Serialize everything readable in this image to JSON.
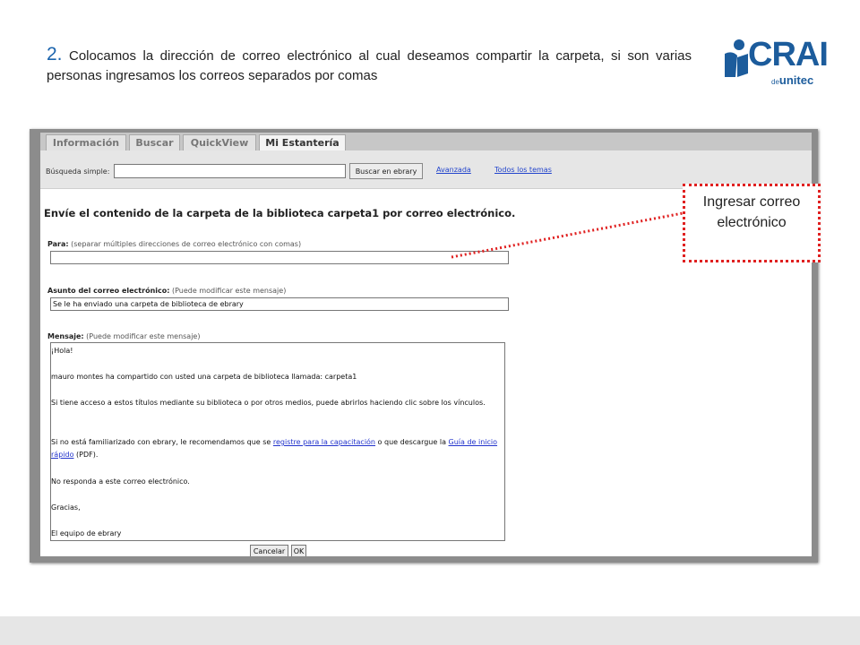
{
  "slide": {
    "step_number": "2.",
    "step_text": "Colocamos la dirección de correo electrónico al cual deseamos compartir la carpeta, si son varias personas ingresamos los correos separados por comas"
  },
  "logo": {
    "brand": "CRAI",
    "sub_prefix": "de",
    "sub": "unitec"
  },
  "tabs": [
    {
      "label": "Información",
      "active": false
    },
    {
      "label": "Buscar",
      "active": false
    },
    {
      "label": "QuickView",
      "active": false
    },
    {
      "label": "Mi Estantería",
      "active": true
    }
  ],
  "search": {
    "label": "Búsqueda simple:",
    "value": "",
    "button": "Buscar en ebrary",
    "advanced": "Avanzada",
    "all_topics": "Todos los temas"
  },
  "form": {
    "title": "Envíe el contenido de la carpeta de la biblioteca carpeta1 por correo electrónico.",
    "to_label": "Para:",
    "to_hint": "(separar múltiples direcciones de correo electrónico con comas)",
    "to_value": "",
    "subject_label": "Asunto del correo electrónico:",
    "subject_hint": "(Puede modificar este mensaje)",
    "subject_value": "Se le ha enviado una carpeta de biblioteca de ebrary",
    "message_label": "Mensaje:",
    "message_hint": "(Puede modificar este mensaje)",
    "message": {
      "greeting": "¡Hola!",
      "line1": "mauro montes ha compartido con usted una carpeta de biblioteca llamada: carpeta1",
      "line2": "Si tiene acceso a estos títulos mediante su biblioteca o por otros medios, puede abrirlos haciendo clic sobre los vínculos.",
      "line3_pre": "Si no está familiarizado con ebrary, le recomendamos que se ",
      "line3_link1": "registre para la capacitación",
      "line3_mid": " o que descargue la ",
      "line3_link2": "Guía de inicio rápido",
      "line3_post": " (PDF).",
      "line4": "No responda a este correo electrónico.",
      "thanks": "Gracias,",
      "signature": "El equipo de ebrary"
    },
    "cancel": "Cancelar",
    "ok": "OK"
  },
  "callout": {
    "text": "Ingresar correo electrónico",
    "color": "#e02020"
  }
}
